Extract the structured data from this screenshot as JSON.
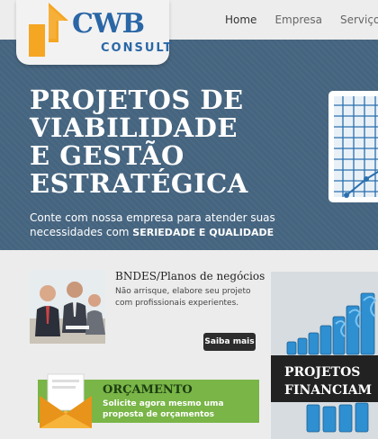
{
  "brand": {
    "name": "CWB",
    "tagline": "CONSULT",
    "accent": "#2a67a6",
    "mark_color": "#f5a623"
  },
  "nav": {
    "items": [
      {
        "label": "Home"
      },
      {
        "label": "Empresa"
      },
      {
        "label": "Serviços"
      }
    ],
    "active": "Home"
  },
  "hero": {
    "title_lines": [
      "PROJETOS DE",
      "VIABILIDADE",
      "E GESTÃO",
      "ESTRATÉGICA"
    ],
    "subtitle_line1": "Conte com nossa empresa para atender suas",
    "subtitle_line2_prefix": "necessidades com ",
    "subtitle_emphasis": "SERIEDADE E QUALIDADE",
    "background": "#45647f"
  },
  "bndes": {
    "title": "BNDES/Planos de negócios",
    "description": "Não arrisque, elabore seu projeto com profissionais experientes.",
    "button_label": "Saiba mais"
  },
  "orcamento": {
    "title": "ORÇAMENTO",
    "description": "Solicite agora mesmo uma proposta de orçamentos",
    "color": "#79b547"
  },
  "projetos_panel": {
    "line1": "PROJETOS",
    "line2": "FINANCIAM"
  }
}
